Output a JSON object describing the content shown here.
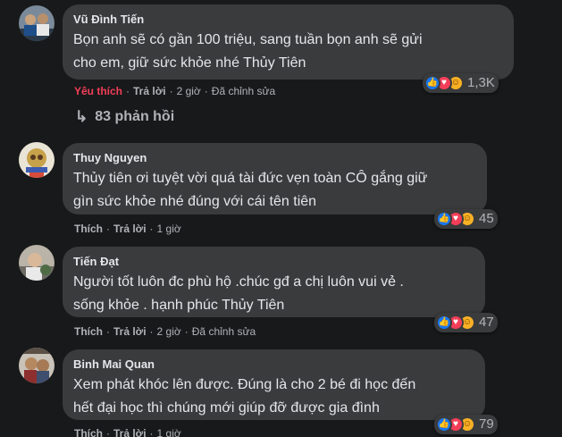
{
  "comments": [
    {
      "author": "Vũ Đình Tiến",
      "lines": [
        "Bọn anh sẽ có gần 100 triệu, sang tuần bọn anh sẽ gửi",
        "cho em, giữ sức khỏe nhé Thủy Tiên"
      ],
      "reaction_count": "1,3K",
      "like_label": "Yêu thích",
      "reply_label": "Trả lời",
      "time": "2 giờ",
      "edited": "Đã chỉnh sửa",
      "liked": true
    },
    {
      "author": "Thuy Nguyen",
      "lines": [
        "Thủy tiên ơi tuyệt vời quá tài đức vẹn toàn CÔ gắng giữ",
        "gìn sức khỏe nhé đúng với cái tên tiên"
      ],
      "reaction_count": "45",
      "like_label": "Thích",
      "reply_label": "Trả lời",
      "time": "1 giờ",
      "edited": "",
      "liked": false
    },
    {
      "author": "Tiến Đạt",
      "lines": [
        "Người tốt luôn đc phù hộ .chúc gđ a chị luôn vui vẻ .",
        "sống khỏe . hạnh phúc Thủy Tiên"
      ],
      "reaction_count": "47",
      "like_label": "Thích",
      "reply_label": "Trả lời",
      "time": "2 giờ",
      "edited": "Đã chỉnh sửa",
      "liked": false
    },
    {
      "author": "Binh Mai Quan",
      "lines": [
        "Xem phát khóc lên được. Đúng là cho 2 bé đi học đến",
        "hết đại học thì chúng mới giúp đỡ được gia đình"
      ],
      "reaction_count": "79",
      "like_label": "Thích",
      "reply_label": "Trả lời",
      "time": "1 giờ",
      "edited": "",
      "liked": false
    }
  ],
  "replies_label": "83 phản hồi",
  "colors": {
    "background": "#18191a",
    "bubble": "#3a3b3c",
    "text": "#e4e6eb",
    "muted": "#b0b3b8",
    "liked": "#f33e58",
    "like_blue": "#1877f2"
  },
  "icons": [
    "like-icon",
    "love-icon",
    "care-icon",
    "reply-arrow-icon"
  ]
}
